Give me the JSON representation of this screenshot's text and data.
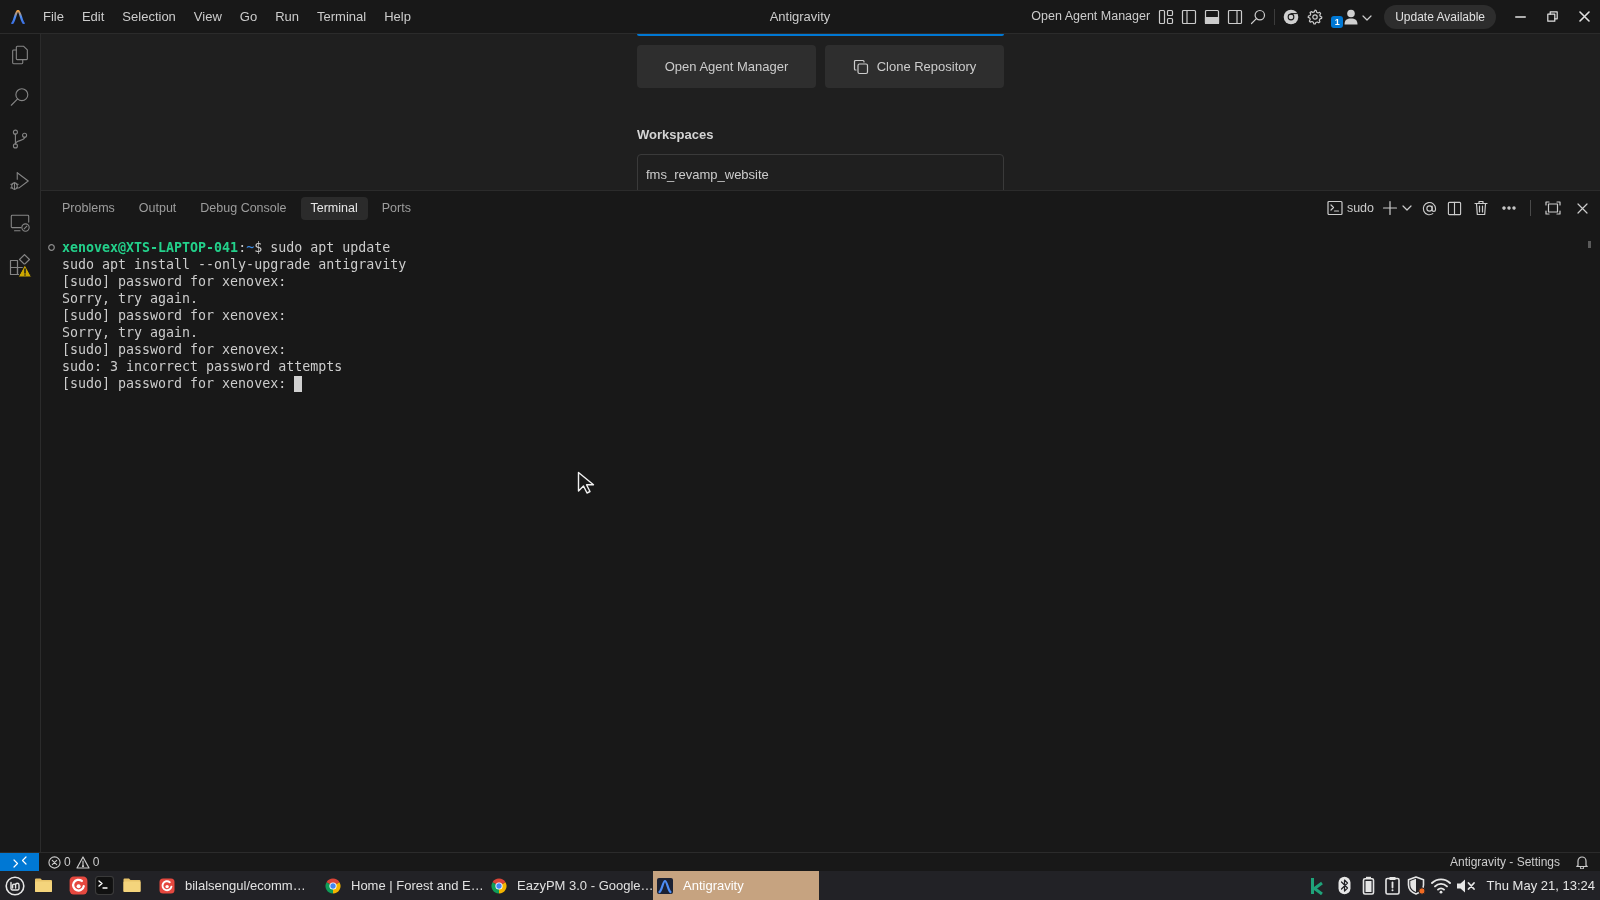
{
  "title_bar": {
    "menu": [
      "File",
      "Edit",
      "Selection",
      "View",
      "Go",
      "Run",
      "Terminal",
      "Help"
    ],
    "title": "Antigravity",
    "agent_manager_link": "Open Agent Manager",
    "account_badge": "1",
    "update_button": "Update Available"
  },
  "welcome": {
    "buttons": [
      {
        "label": "Open Agent Manager",
        "kind": "plain"
      },
      {
        "label": "Clone Repository",
        "kind": "clone"
      }
    ],
    "workspaces_heading": "Workspaces",
    "workspaces": [
      {
        "name": "fms_revamp_website"
      }
    ]
  },
  "panel": {
    "tabs": [
      {
        "label": "Problems",
        "selected": false
      },
      {
        "label": "Output",
        "selected": false
      },
      {
        "label": "Debug Console",
        "selected": false
      },
      {
        "label": "Terminal",
        "selected": true
      },
      {
        "label": "Ports",
        "selected": false
      }
    ],
    "terminal_name": "sudo",
    "prompt": {
      "user_host": "xenovex@XTS-LAPTOP-041",
      "separator": ":",
      "path": "~",
      "symbol": "$",
      "command": "sudo apt update"
    },
    "output_lines": [
      "sudo apt install --only-upgrade antigravity",
      "[sudo] password for xenovex:",
      "Sorry, try again.",
      "[sudo] password for xenovex:",
      "Sorry, try again.",
      "[sudo] password for xenovex:",
      "sudo: 3 incorrect password attempts",
      "[sudo] password for xenovex:"
    ],
    "cursor_visible": true
  },
  "status_bar": {
    "errors": "0",
    "warnings": "0",
    "right_item": "Antigravity - Settings"
  },
  "taskbar": {
    "windows": [
      {
        "title": "bilalsengul/ecomm…",
        "kind": "browser",
        "selected": false
      },
      {
        "title": "Home | Forest and E…",
        "kind": "chrome",
        "selected": false
      },
      {
        "title": "EazyPM 3.0 - Google…",
        "kind": "chrome",
        "selected": false
      },
      {
        "title": "Antigravity",
        "kind": "editor",
        "selected": true
      }
    ],
    "clock": "Thu May 21, 13:24"
  }
}
